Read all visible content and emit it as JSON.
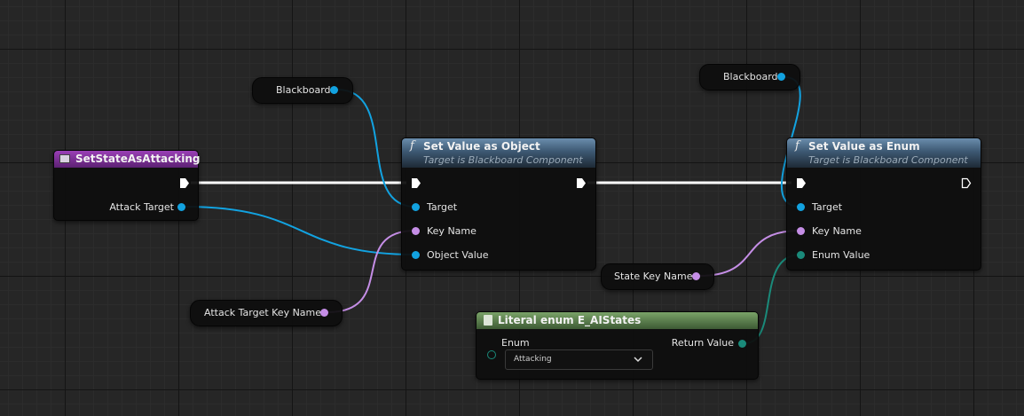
{
  "nodes": {
    "event": {
      "title": "SetStateAsAttacking",
      "pins": {
        "attack_target": "Attack Target"
      },
      "header_color": "#9a3fb6"
    },
    "set_object": {
      "title": "Set Value as Object",
      "subtitle": "Target is Blackboard Component",
      "pins": {
        "target": "Target",
        "key_name": "Key Name",
        "object_value": "Object Value"
      }
    },
    "set_enum": {
      "title": "Set Value as Enum",
      "subtitle": "Target is Blackboard Component",
      "pins": {
        "target": "Target",
        "key_name": "Key Name",
        "enum_value": "Enum Value"
      }
    },
    "literal_enum": {
      "title": "Literal enum E_AIStates",
      "pins": {
        "enum": "Enum",
        "return_value": "Return Value"
      },
      "selected_value": "Attacking",
      "header_color": "#7aa368"
    },
    "blackboard_1": {
      "label": "Blackboard"
    },
    "blackboard_2": {
      "label": "Blackboard"
    },
    "attack_target_key": {
      "label": "Attack Target Key Name"
    },
    "state_key": {
      "label": "State Key Name"
    }
  },
  "pin_colors": {
    "object": "#12a2e0",
    "name": "#c58ee6",
    "enum": "#1a8a7a",
    "exec": "#ffffff"
  },
  "icons": {
    "function": "function-f-icon",
    "event": "event-icon",
    "enum": "enum-literal-icon",
    "exec": "exec-arrow-icon",
    "dropdown": "chevron-down-icon"
  }
}
